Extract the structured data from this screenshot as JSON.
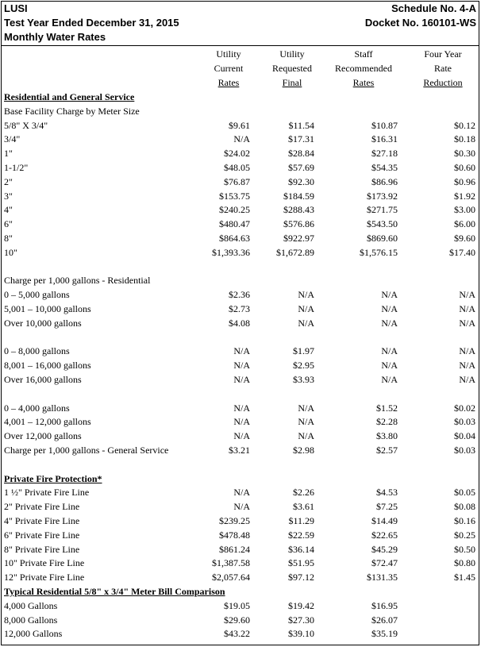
{
  "header": {
    "company": "LUSI",
    "schedule": "Schedule No. 4-A",
    "test_year": "Test Year Ended December 31, 2015",
    "docket": "Docket No. 160101-WS",
    "title": "Monthly Water Rates"
  },
  "columns": [
    {
      "lines": [
        "Utility",
        "Current",
        "Rates"
      ]
    },
    {
      "lines": [
        "Utility",
        "Requested",
        "Final"
      ]
    },
    {
      "lines": [
        "Staff",
        "Recommended",
        "Rates"
      ]
    },
    {
      "lines": [
        "Four Year",
        "Rate",
        "Reduction"
      ]
    }
  ],
  "rows": [
    {
      "label": "Residential and General Service",
      "section": true,
      "values": [
        "",
        "",
        "",
        ""
      ]
    },
    {
      "label": "Base Facility Charge by Meter Size",
      "values": [
        "",
        "",
        "",
        ""
      ]
    },
    {
      "label": "5/8\" X 3/4\"",
      "values": [
        "$9.61",
        "$11.54",
        "$10.87",
        "$0.12"
      ]
    },
    {
      "label": "3/4\"",
      "values": [
        "N/A",
        "$17.31",
        "$16.31",
        "$0.18"
      ]
    },
    {
      "label": "1\"",
      "values": [
        "$24.02",
        "$28.84",
        "$27.18",
        "$0.30"
      ]
    },
    {
      "label": "1-1/2\"",
      "values": [
        "$48.05",
        "$57.69",
        "$54.35",
        "$0.60"
      ]
    },
    {
      "label": "2\"",
      "values": [
        "$76.87",
        "$92.30",
        "$86.96",
        "$0.96"
      ]
    },
    {
      "label": "3\"",
      "values": [
        "$153.75",
        "$184.59",
        "$173.92",
        "$1.92"
      ]
    },
    {
      "label": "4\"",
      "values": [
        "$240.25",
        "$288.43",
        "$271.75",
        "$3.00"
      ]
    },
    {
      "label": "6\"",
      "values": [
        "$480.47",
        "$576.86",
        "$543.50",
        "$6.00"
      ]
    },
    {
      "label": "8\"",
      "values": [
        "$864.63",
        "$922.97",
        "$869.60",
        "$9.60"
      ]
    },
    {
      "label": "10\"",
      "values": [
        "$1,393.36",
        "$1,672.89",
        "$1,576.15",
        "$17.40"
      ]
    },
    {
      "label": "",
      "values": [
        "",
        "",
        "",
        ""
      ]
    },
    {
      "label": "Charge per 1,000 gallons  - Residential",
      "values": [
        "",
        "",
        "",
        ""
      ]
    },
    {
      "label": "0 – 5,000 gallons",
      "values": [
        "$2.36",
        "N/A",
        "N/A",
        "N/A"
      ]
    },
    {
      "label": "5,001 – 10,000 gallons",
      "values": [
        "$2.73",
        "N/A",
        "N/A",
        "N/A"
      ]
    },
    {
      "label": "Over 10,000 gallons",
      "values": [
        "$4.08",
        "N/A",
        "N/A",
        "N/A"
      ]
    },
    {
      "label": "",
      "values": [
        "",
        "",
        "",
        ""
      ]
    },
    {
      "label": "0 – 8,000 gallons",
      "values": [
        "N/A",
        "$1.97",
        "N/A",
        "N/A"
      ]
    },
    {
      "label": "8,001 – 16,000 gallons",
      "values": [
        "N/A",
        "$2.95",
        "N/A",
        "N/A"
      ]
    },
    {
      "label": "Over 16,000 gallons",
      "values": [
        "N/A",
        "$3.93",
        "N/A",
        "N/A"
      ]
    },
    {
      "label": "",
      "values": [
        "",
        "",
        "",
        ""
      ]
    },
    {
      "label": "0 – 4,000 gallons",
      "values": [
        "N/A",
        "N/A",
        "$1.52",
        "$0.02"
      ]
    },
    {
      "label": "4,001 – 12,000 gallons",
      "values": [
        "N/A",
        "N/A",
        "$2.28",
        "$0.03"
      ]
    },
    {
      "label": "Over 12,000 gallons",
      "values": [
        "N/A",
        "N/A",
        "$3.80",
        "$0.04"
      ]
    },
    {
      "label": "Charge per 1,000 gallons  - General Service",
      "values": [
        "$3.21",
        "$2.98",
        "$2.57",
        "$0.03"
      ]
    },
    {
      "label": "",
      "values": [
        "",
        "",
        "",
        ""
      ]
    },
    {
      "label": "Private Fire Protection*",
      "section": true,
      "values": [
        "",
        "",
        "",
        ""
      ]
    },
    {
      "label": "1 ½\" Private Fire Line",
      "values": [
        "N/A",
        "$2.26",
        "$4.53",
        "$0.05"
      ]
    },
    {
      "label": "2\" Private Fire Line",
      "values": [
        "N/A",
        "$3.61",
        "$7.25",
        "$0.08"
      ]
    },
    {
      "label": "4\" Private Fire Line",
      "values": [
        "$239.25",
        "$11.29",
        "$14.49",
        "$0.16"
      ]
    },
    {
      "label": "6\" Private Fire Line",
      "values": [
        "$478.48",
        "$22.59",
        "$22.65",
        "$0.25"
      ]
    },
    {
      "label": "8\" Private Fire Line",
      "values": [
        "$861.24",
        "$36.14",
        "$45.29",
        "$0.50"
      ]
    },
    {
      "label": "10\" Private Fire Line",
      "values": [
        "$1,387.58",
        "$51.95",
        "$72.47",
        "$0.80"
      ]
    },
    {
      "label": "12\" Private Fire Line",
      "values": [
        "$2,057.64",
        "$97.12",
        "$131.35",
        "$1.45"
      ]
    },
    {
      "label": "Typical Residential 5/8\" x 3/4\" Meter Bill Comparison",
      "section": true,
      "values": [
        "",
        "",
        "",
        ""
      ]
    },
    {
      "label": "4,000 Gallons",
      "values": [
        "$19.05",
        "$19.42",
        "$16.95",
        ""
      ]
    },
    {
      "label": "8,000 Gallons",
      "values": [
        "$29.60",
        "$27.30",
        "$26.07",
        ""
      ]
    },
    {
      "label": "12,000 Gallons",
      "values": [
        "$43.22",
        "$39.10",
        "$35.19",
        ""
      ]
    }
  ]
}
